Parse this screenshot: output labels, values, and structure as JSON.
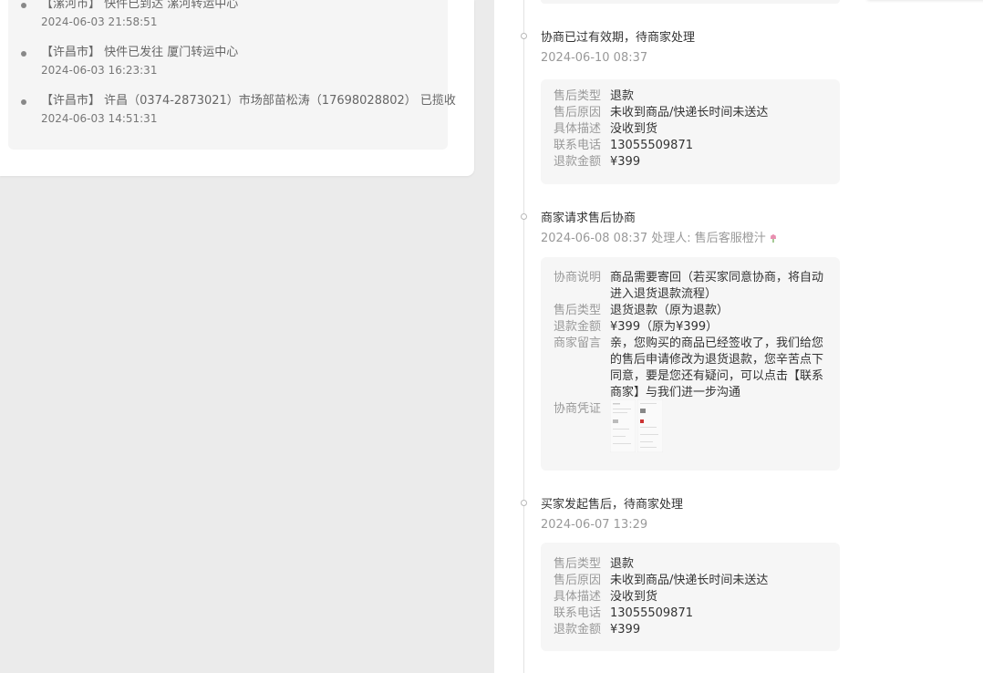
{
  "logistics": [
    {
      "text": "【漯河市】 快件已到达 漯河转运中心",
      "time": "2024-06-03 21:58:51"
    },
    {
      "text": "【许昌市】 快件已发往 厦门转运中心",
      "time": "2024-06-03 16:23:31"
    },
    {
      "text": "【许昌市】 许昌（0374-2873021）市场部苗松涛（17698028802） 已揽收",
      "time": "2024-06-03 14:51:31"
    }
  ],
  "timeline": [
    {
      "title": "协商已过有效期，待商家处理",
      "time": "2024-06-10 08:37",
      "details": [
        {
          "key": "售后类型",
          "value": "退款"
        },
        {
          "key": "售后原因",
          "value": "未收到商品/快递长时间未送达"
        },
        {
          "key": "具体描述",
          "value": "没收到货"
        },
        {
          "key": "联系电话",
          "value": "13055509871"
        },
        {
          "key": "退款金额",
          "value": "¥399"
        }
      ]
    },
    {
      "title": "商家请求售后协商",
      "time": "2024-06-08 08:37 处理人: 售后客服橙汁",
      "handler_icon": "tulip-icon",
      "details": [
        {
          "key": "协商说明",
          "value": "商品需要寄回（若买家同意协商，将自动进入退货退款流程）"
        },
        {
          "key": "售后类型",
          "value": "退货退款（原为退款）"
        },
        {
          "key": "退款金额",
          "value": "¥399（原为¥399）"
        },
        {
          "key": "商家留言",
          "value": "亲，您购买的商品已经签收了，我们给您的售后申请修改为退货退款，您辛苦点下同意，要是您还有疑问，可以点击【联系商家】与我们进一步沟通"
        },
        {
          "key": "协商凭证",
          "value": ""
        }
      ]
    },
    {
      "title": "买家发起售后，待商家处理",
      "time": "2024-06-07 13:29",
      "details": [
        {
          "key": "售后类型",
          "value": "退款"
        },
        {
          "key": "售后原因",
          "value": "未收到商品/快递长时间未送达"
        },
        {
          "key": "具体描述",
          "value": "没收到货"
        },
        {
          "key": "联系电话",
          "value": "13055509871"
        },
        {
          "key": "退款金额",
          "value": "¥399"
        }
      ]
    }
  ]
}
